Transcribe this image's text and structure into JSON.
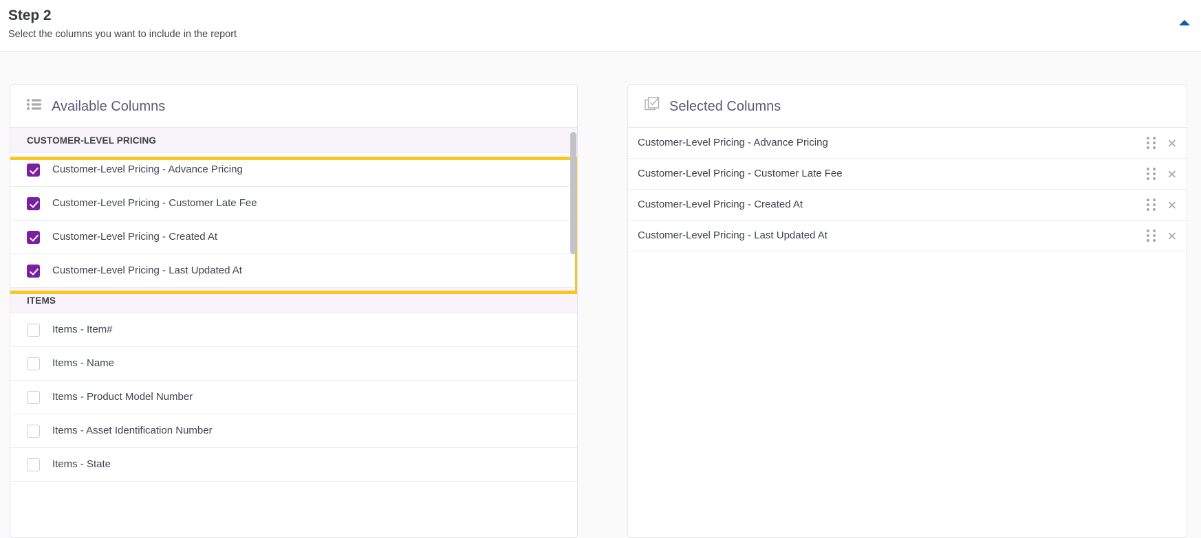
{
  "step": {
    "title": "Step 2",
    "subtitle": "Select the columns you want to include in the report",
    "collapse_icon": "caret-up-icon",
    "collapse_color": "#0a5ca8"
  },
  "available_panel": {
    "title": "Available Columns",
    "icon": "list-icon",
    "groups": [
      {
        "name": "CUSTOMER-LEVEL PRICING",
        "highlighted": true,
        "options": [
          {
            "label": "Customer-Level Pricing - Advance Pricing",
            "checked": true
          },
          {
            "label": "Customer-Level Pricing - Customer Late Fee",
            "checked": true
          },
          {
            "label": "Customer-Level Pricing - Created At",
            "checked": true
          },
          {
            "label": "Customer-Level Pricing - Last Updated At",
            "checked": true
          }
        ]
      },
      {
        "name": "ITEMS",
        "highlighted": false,
        "options": [
          {
            "label": "Items - Item#",
            "checked": false
          },
          {
            "label": "Items - Name",
            "checked": false
          },
          {
            "label": "Items - Product Model Number",
            "checked": false
          },
          {
            "label": "Items - Asset Identification Number",
            "checked": false
          },
          {
            "label": "Items - State",
            "checked": false
          }
        ]
      }
    ]
  },
  "selected_panel": {
    "title": "Selected Columns",
    "icon": "checked-box-icon",
    "rows": [
      {
        "label": "Customer-Level Pricing - Advance Pricing",
        "drag_icon": "drag-handle-icon",
        "remove_icon": "close-icon"
      },
      {
        "label": "Customer-Level Pricing - Customer Late Fee",
        "drag_icon": "drag-handle-icon",
        "remove_icon": "close-icon"
      },
      {
        "label": "Customer-Level Pricing - Created At",
        "drag_icon": "drag-handle-icon",
        "remove_icon": "close-icon"
      },
      {
        "label": "Customer-Level Pricing - Last Updated At",
        "drag_icon": "drag-handle-icon",
        "remove_icon": "close-icon"
      }
    ]
  },
  "colors": {
    "checkbox_checked": "#7b1fa2",
    "highlight_ring": "#fbc521",
    "group_header_bg": "#f8f4f9",
    "panel_title": "#5e5873",
    "workspace_bg": "#fafafb"
  }
}
